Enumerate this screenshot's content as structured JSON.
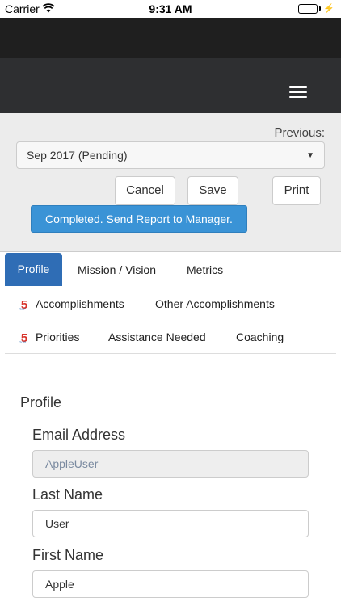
{
  "status_bar": {
    "carrier": "Carrier",
    "time": "9:31 AM"
  },
  "header": {
    "menu_icon": "hamburger-menu-icon"
  },
  "controls": {
    "previous_label": "Previous:",
    "period_selected": "Sep 2017 (Pending)",
    "cancel_label": "Cancel",
    "save_label": "Save",
    "print_label": "Print",
    "complete_label": "Completed. Send Report to Manager."
  },
  "tabs": {
    "profile": "Profile",
    "mission_vision": "Mission / Vision",
    "metrics": "Metrics",
    "accomplishments": "Accomplishments",
    "other_accomplishments": "Other Accomplishments",
    "priorities": "Priorities",
    "assistance_needed": "Assistance Needed",
    "coaching": "Coaching",
    "icon": "top-5-badge-icon",
    "icon_color": "#d9342b"
  },
  "profile": {
    "section_title": "Profile",
    "email_label": "Email Address",
    "email_value": "AppleUser",
    "last_name_label": "Last Name",
    "last_name_value": "User",
    "first_name_label": "First Name",
    "first_name_value": "Apple"
  },
  "colors": {
    "active_tab": "#2f6db5",
    "primary_button": "#3a93d6",
    "navbar": "#2e2f31"
  }
}
